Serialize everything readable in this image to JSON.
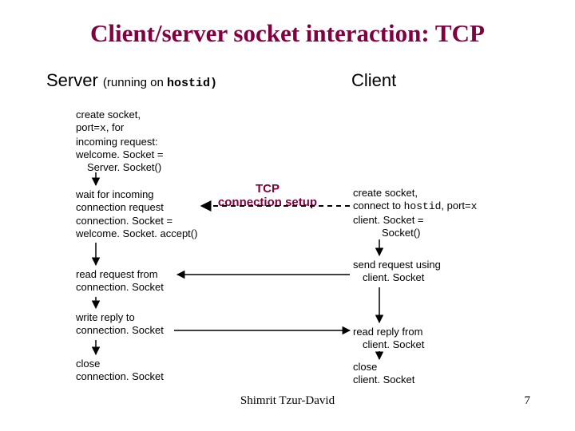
{
  "title": "Client/server socket interaction: TCP",
  "server_heading": "Server",
  "server_running": "(running on ",
  "server_hostid": "hostid)",
  "client_heading": "Client",
  "server": {
    "create_l1": "create socket,",
    "create_l2_a": "port=",
    "create_l2_b": "x",
    "create_l2_c": ", for",
    "create_l3": "incoming request:",
    "create_l4": "welcome. Socket =",
    "create_l5": "Server. Socket()",
    "wait_l1": "wait for incoming",
    "wait_l2": "connection request",
    "wait_l3": "connection. Socket =",
    "wait_l4": "welcome. Socket. accept()",
    "read_l1": "read request from",
    "read_l2": "connection. Socket",
    "write_l1": "write reply to",
    "write_l2": "connection. Socket",
    "close_l1": "close",
    "close_l2": "connection. Socket"
  },
  "client": {
    "create_l1": "create socket,",
    "create_l2a": "connect to ",
    "create_l2b": "hostid",
    "create_l2c": ", port=",
    "create_l2d": "x",
    "create_l3": "client. Socket =",
    "create_l4": "Socket()",
    "send_l1": "send request using",
    "send_l2": "client. Socket",
    "read_l1": "read reply from",
    "read_l2": "client. Socket",
    "close_l1": "close",
    "close_l2": "client. Socket"
  },
  "tcp_label_l1": "TCP",
  "tcp_label_l2": "connection setup",
  "footer": "Shimrit Tzur-David",
  "page": "7"
}
